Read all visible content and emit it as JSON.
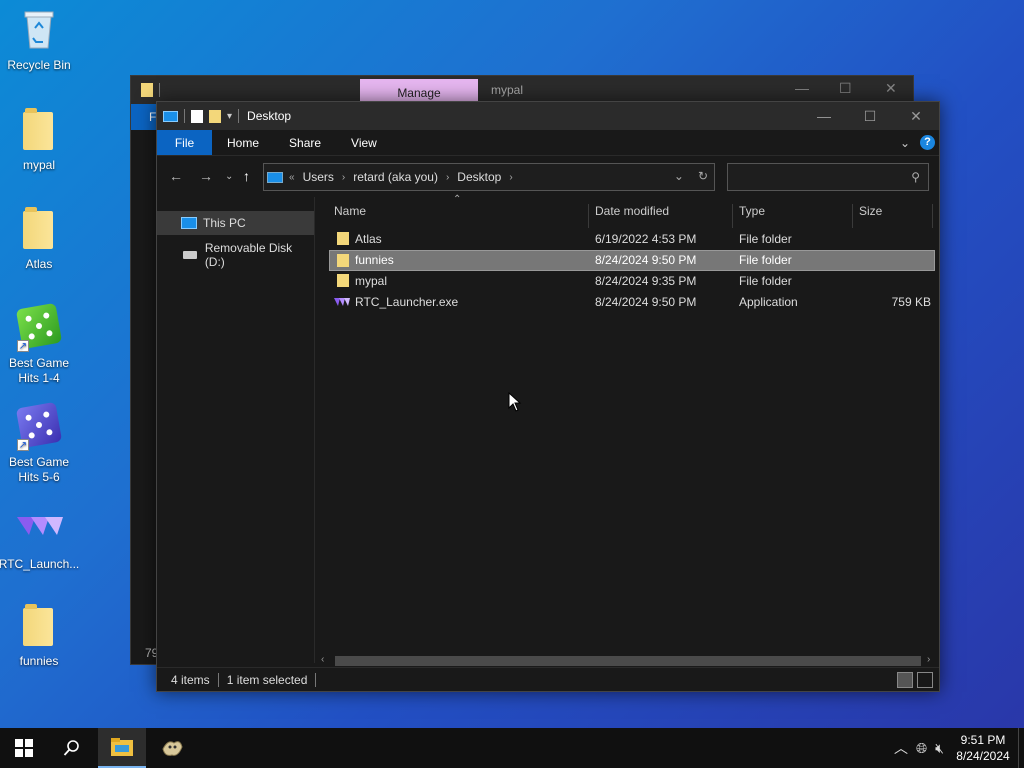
{
  "desktop_icons": [
    {
      "label": "Recycle Bin",
      "icon": "recycle-bin-icon"
    },
    {
      "label": "mypal",
      "icon": "folder-icon"
    },
    {
      "label": "Atlas",
      "icon": "folder-icon"
    },
    {
      "label": "Best Game Hits 1-4",
      "icon": "dice-green-icon"
    },
    {
      "label": "Best Game Hits 5-6",
      "icon": "dice-purple-icon"
    },
    {
      "label": "RTC_Launch...",
      "icon": "rtc-launcher-icon"
    },
    {
      "label": "funnies",
      "icon": "folder-icon"
    }
  ],
  "back_window": {
    "manage_tab": "Manage",
    "title": "mypal",
    "ribbon_fragment": "F",
    "status_fragment": "79"
  },
  "window": {
    "title": "Desktop",
    "ribbon": {
      "tabs": [
        "File",
        "Home",
        "Share",
        "View"
      ]
    },
    "address": {
      "crumbs": [
        "Users",
        "retard (aka you)",
        "Desktop"
      ],
      "leading": "«"
    },
    "search": {
      "placeholder": ""
    },
    "sidebar": [
      {
        "label": "This PC",
        "icon": "this-pc-icon",
        "selected": true
      },
      {
        "label": "Removable Disk (D:)",
        "icon": "usb-drive-icon",
        "selected": false
      }
    ],
    "columns": [
      "Name",
      "Date modified",
      "Type",
      "Size"
    ],
    "rows": [
      {
        "name": "Atlas",
        "date": "6/19/2022 4:53 PM",
        "type": "File folder",
        "size": "",
        "icon": "folder-icon"
      },
      {
        "name": "funnies",
        "date": "8/24/2024 9:50 PM",
        "type": "File folder",
        "size": "",
        "icon": "folder-icon",
        "selected": true
      },
      {
        "name": "mypal",
        "date": "8/24/2024 9:35 PM",
        "type": "File folder",
        "size": "",
        "icon": "folder-icon"
      },
      {
        "name": "RTC_Launcher.exe",
        "date": "8/24/2024 9:50 PM",
        "type": "Application",
        "size": "759 KB",
        "icon": "rtc-launcher-icon"
      }
    ],
    "status": {
      "count": "4 items",
      "selected": "1 item selected"
    }
  },
  "taskbar": {
    "time": "9:51 PM",
    "date": "8/24/2024"
  },
  "colors": {
    "accent": "#0b64c2",
    "manage_tab": "#e6b6f0",
    "selection": "#777777"
  }
}
